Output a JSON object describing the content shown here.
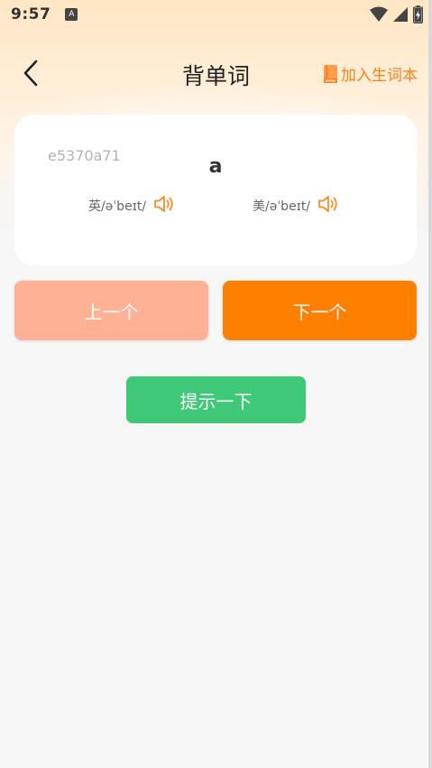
{
  "status_bar": {
    "time": "9:57",
    "app_badge": "A",
    "icons": [
      "wifi-icon",
      "signal-icon",
      "battery-icon"
    ]
  },
  "header": {
    "back_icon": "chevron-left-icon",
    "title": "背单词",
    "add_vocab_label": "加入生词本",
    "add_vocab_icon": "book-icon"
  },
  "word_card": {
    "id": "e5370a71",
    "word": "a",
    "uk": {
      "label": "英/əˈbeɪt/",
      "icon": "speaker-icon"
    },
    "us": {
      "label": "美/əˈbeɪt/",
      "icon": "speaker-icon"
    }
  },
  "buttons": {
    "prev_label": "上一个",
    "next_label": "下一个",
    "hint_label": "提示一下"
  },
  "colors": {
    "accent": "#ff7f00",
    "prev_button": "#ffb196",
    "hint_button": "#3ec877",
    "add_vocab": "#ff7f1a"
  }
}
